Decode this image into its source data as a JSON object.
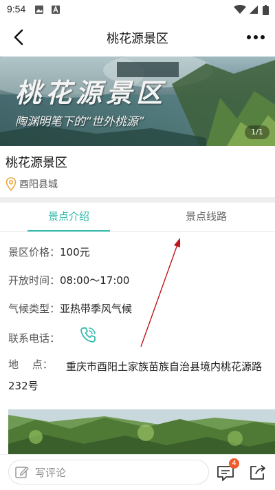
{
  "status_bar": {
    "time": "9:54"
  },
  "header": {
    "title": "桃花源景区"
  },
  "banner": {
    "title": "桃花源景区",
    "subtitle": "陶渊明笔下的“世外桃源”",
    "page_indicator": "1/1"
  },
  "scenic": {
    "name": "桃花源景区",
    "location": "酉阳县城"
  },
  "tabs": [
    {
      "label": "景点介绍",
      "active": true
    },
    {
      "label": "景点线路",
      "active": false
    }
  ],
  "details": {
    "price_label": "景区价格：",
    "price_value": "100元",
    "hours_label": "开放时间：",
    "hours_value": "08:00～17:00",
    "climate_label": "气候类型：",
    "climate_value": "亚热带季风气候",
    "phone_label": "联系电话：",
    "address_label": "地　 点：",
    "address_value": "重庆市酉阳土家族苗族自治县境内桃花源路232号"
  },
  "bottom_bar": {
    "comment_placeholder": "写评论",
    "message_badge": "4"
  },
  "colors": {
    "accent": "#2fb8a8",
    "badge": "#ef5a2a",
    "annotation": "#c0141b",
    "location_icon": "#f0a63a"
  },
  "icons": [
    "back-arrow-icon",
    "more-icon",
    "location-pin-icon",
    "phone-icon",
    "edit-icon",
    "message-icon",
    "share-icon"
  ]
}
